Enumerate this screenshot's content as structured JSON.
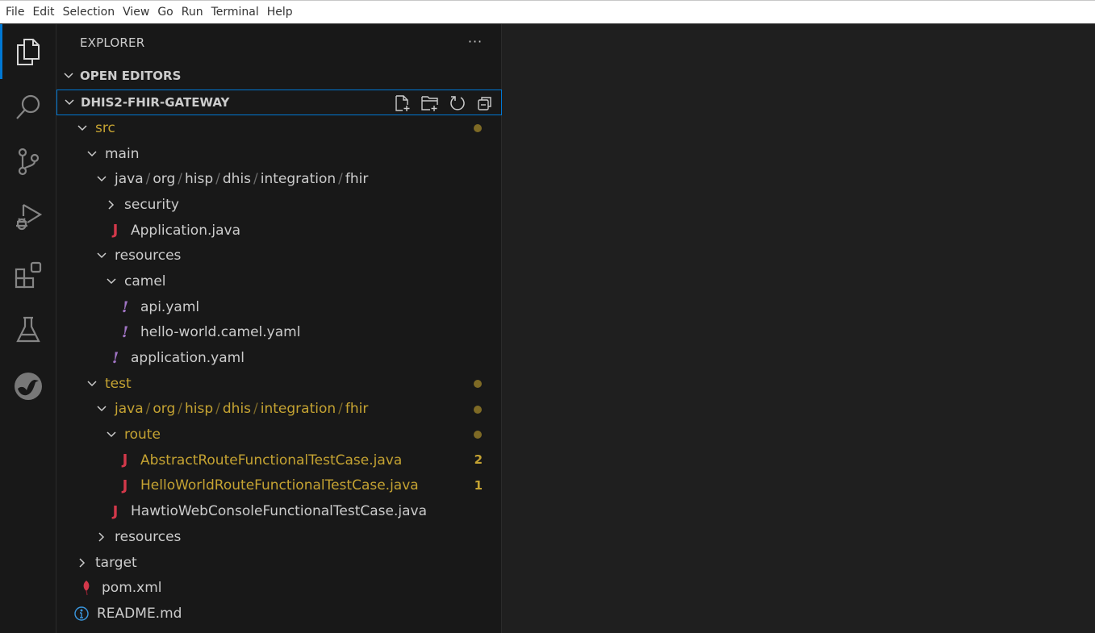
{
  "menubar": {
    "items": [
      "File",
      "Edit",
      "Selection",
      "View",
      "Go",
      "Run",
      "Terminal",
      "Help"
    ]
  },
  "activitybar": {
    "items": [
      {
        "name": "explorer",
        "icon": "files-icon",
        "active": true
      },
      {
        "name": "search",
        "icon": "search-icon",
        "active": false
      },
      {
        "name": "source-control",
        "icon": "source-control-icon",
        "active": false
      },
      {
        "name": "run-and-debug",
        "icon": "run-debug-icon",
        "active": false
      },
      {
        "name": "extensions",
        "icon": "extensions-icon",
        "active": false
      },
      {
        "name": "testing",
        "icon": "beaker-icon",
        "active": false
      },
      {
        "name": "camel",
        "icon": "camel-icon",
        "active": false
      }
    ]
  },
  "sidebar": {
    "title": "EXPLORER",
    "more_label": "···",
    "open_editors": "OPEN EDITORS",
    "workspace": "DHIS2-FHIR-GATEWAY",
    "workspace_actions": [
      "new-file",
      "new-folder",
      "refresh",
      "collapse-all"
    ]
  },
  "tree": [
    {
      "label": "src",
      "type": "folder",
      "expanded": true,
      "depth": 1,
      "modified": true,
      "badge": "dot"
    },
    {
      "label": "main",
      "type": "folder",
      "expanded": true,
      "depth": 2
    },
    {
      "label": "java/org/hisp/dhis/integration/fhir",
      "type": "folder",
      "expanded": true,
      "depth": 3,
      "segments": [
        "java",
        "org",
        "hisp",
        "dhis",
        "integration",
        "fhir"
      ]
    },
    {
      "label": "security",
      "type": "folder",
      "expanded": false,
      "depth": 4
    },
    {
      "label": "Application.java",
      "type": "java",
      "depth": 4
    },
    {
      "label": "resources",
      "type": "folder",
      "expanded": true,
      "depth": 3
    },
    {
      "label": "camel",
      "type": "folder",
      "expanded": true,
      "depth": 4
    },
    {
      "label": "api.yaml",
      "type": "yaml",
      "depth": 5
    },
    {
      "label": "hello-world.camel.yaml",
      "type": "yaml",
      "depth": 5
    },
    {
      "label": "application.yaml",
      "type": "yaml",
      "depth": 4
    },
    {
      "label": "test",
      "type": "folder",
      "expanded": true,
      "depth": 2,
      "modified": true,
      "badge": "dot"
    },
    {
      "label": "java/org/hisp/dhis/integration/fhir",
      "type": "folder",
      "expanded": true,
      "depth": 3,
      "modified": true,
      "badge": "dot",
      "segments": [
        "java",
        "org",
        "hisp",
        "dhis",
        "integration",
        "fhir"
      ]
    },
    {
      "label": "route",
      "type": "folder",
      "expanded": true,
      "depth": 4,
      "modified": true,
      "badge": "dot"
    },
    {
      "label": "AbstractRouteFunctionalTestCase.java",
      "type": "java",
      "depth": 5,
      "modified": true,
      "badge": "2"
    },
    {
      "label": "HelloWorldRouteFunctionalTestCase.java",
      "type": "java",
      "depth": 5,
      "modified": true,
      "badge": "1"
    },
    {
      "label": "HawtioWebConsoleFunctionalTestCase.java",
      "type": "java",
      "depth": 4
    },
    {
      "label": "resources",
      "type": "folder",
      "expanded": false,
      "depth": 3
    },
    {
      "label": "target",
      "type": "folder",
      "expanded": false,
      "depth": 1
    },
    {
      "label": "pom.xml",
      "type": "maven",
      "depth": 1
    },
    {
      "label": "README.md",
      "type": "info",
      "depth": 1
    }
  ],
  "colors": {
    "accent": "#0078d4",
    "modified": "#c5a332",
    "java": "#d3384a",
    "yaml": "#a074c4",
    "info": "#3794ff"
  }
}
